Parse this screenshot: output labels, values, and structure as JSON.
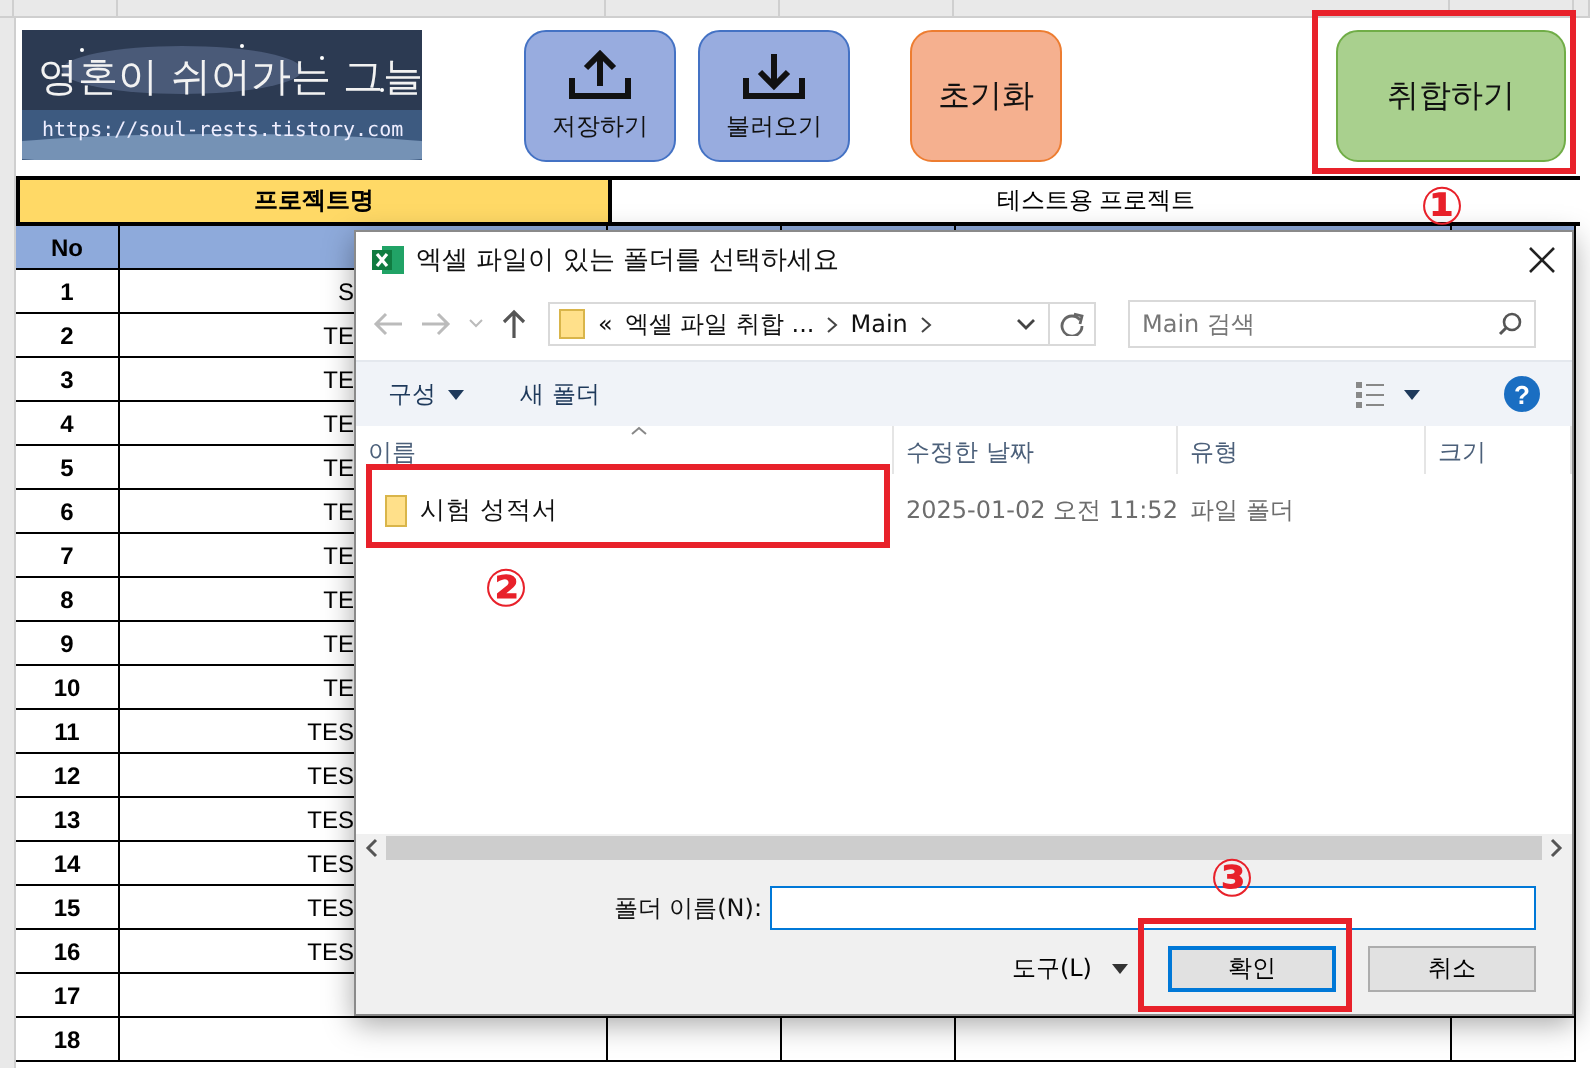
{
  "banner": {
    "title": "영혼이 쉬어가는 그늘",
    "url": "https://soul-rests.tistory.com"
  },
  "sheet_buttons": [
    {
      "label": "저장하기",
      "kind": "upload",
      "color": "#98acdf"
    },
    {
      "label": "불러오기",
      "kind": "download",
      "color": "#98acdf"
    },
    {
      "label": "초기화",
      "kind": "plain",
      "color": "#f5b08f"
    },
    {
      "label": "취합하기",
      "kind": "plain",
      "color": "#a9d08e"
    }
  ],
  "project": {
    "label": "프로젝트명",
    "value": "테스트용 프로젝트"
  },
  "table": {
    "columns": [
      "No"
    ],
    "rows": [
      {
        "no": "1",
        "column_2": "S"
      },
      {
        "no": "2",
        "column_2": "TE"
      },
      {
        "no": "3",
        "column_2": "TE"
      },
      {
        "no": "4",
        "column_2": "TE"
      },
      {
        "no": "5",
        "column_2": "TE"
      },
      {
        "no": "6",
        "column_2": "TE"
      },
      {
        "no": "7",
        "column_2": "TE"
      },
      {
        "no": "8",
        "column_2": "TE"
      },
      {
        "no": "9",
        "column_2": "TE"
      },
      {
        "no": "10",
        "column_2": "TE"
      },
      {
        "no": "11",
        "column_2": "TES"
      },
      {
        "no": "12",
        "column_2": "TES"
      },
      {
        "no": "13",
        "column_2": "TES"
      },
      {
        "no": "14",
        "column_2": "TES"
      },
      {
        "no": "15",
        "column_2": "TES"
      },
      {
        "no": "16",
        "column_2": "TES"
      },
      {
        "no": "17"
      },
      {
        "no": "18"
      }
    ]
  },
  "dialog": {
    "title": "엑셀 파일이 있는 폴더를 선택하세요",
    "breadcrumb": [
      "엑셀 파일 취합 ...",
      "Main"
    ],
    "breadcrumb_overflow": "«",
    "search": {
      "placeholder": "Main 검색"
    },
    "commands": [
      {
        "label": "구성",
        "dropdown": true
      },
      {
        "label": "새 폴더",
        "dropdown": false
      }
    ],
    "help": "?",
    "columns": [
      "이름",
      "수정한 날짜",
      "유형",
      "크기"
    ],
    "files": [
      {
        "name": "시험 성적서",
        "modified": "2025-01-02 오전 11:52",
        "type": "파일 폴더"
      }
    ],
    "folder_name": {
      "label": "폴더 이름(N):"
    },
    "tools": "도구(L)",
    "buttons": [
      {
        "label": "확인",
        "default": true
      },
      {
        "label": "취소",
        "default": false
      }
    ]
  },
  "annotations": [
    {
      "number": "①"
    },
    {
      "number": "②"
    },
    {
      "number": "③"
    }
  ]
}
